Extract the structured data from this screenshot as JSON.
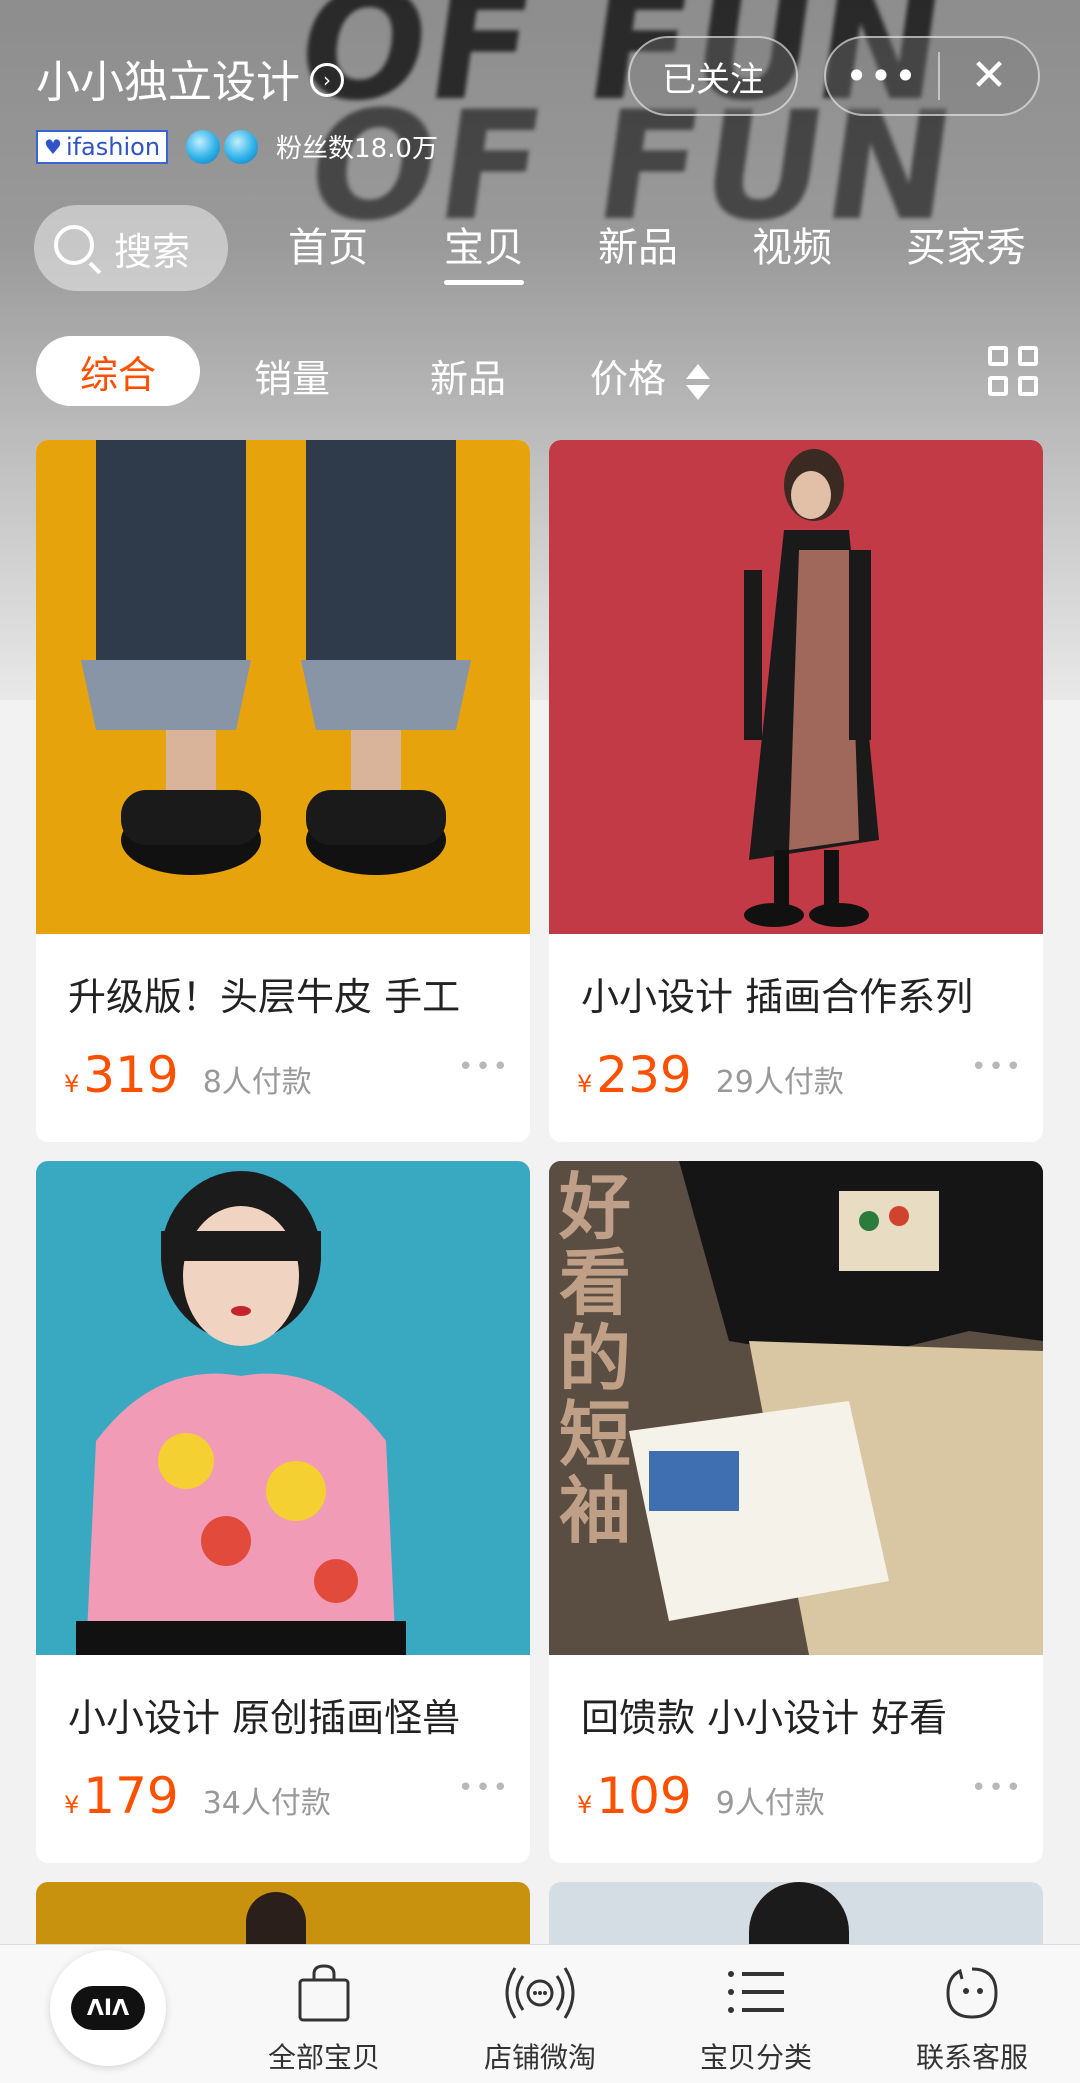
{
  "shop": {
    "name": "小小独立设计",
    "follow_label": "已关注",
    "badge_label": "ifashion",
    "fans_text": "粉丝数18.0万"
  },
  "window_controls": {
    "more_icon": "more-dots-icon",
    "close_icon": "close-icon"
  },
  "search": {
    "label": "搜索"
  },
  "nav_tabs": [
    {
      "label": "首页"
    },
    {
      "label": "宝贝",
      "active": true
    },
    {
      "label": "新品"
    },
    {
      "label": "视频"
    },
    {
      "label": "买家秀"
    }
  ],
  "sort": {
    "items": [
      {
        "label": "综合",
        "active": true
      },
      {
        "label": "销量"
      },
      {
        "label": "新品"
      },
      {
        "label": "价格"
      }
    ]
  },
  "products": [
    {
      "title": "升级版！头层牛皮 手工",
      "yen": "¥",
      "price": "319",
      "sold": "8人付款"
    },
    {
      "title": "小小设计 插画合作系列",
      "yen": "¥",
      "price": "239",
      "sold": "29人付款"
    },
    {
      "title": "小小设计 原创插画怪兽",
      "yen": "¥",
      "price": "179",
      "sold": "34人付款"
    },
    {
      "title": "回馈款 小小设计  好看",
      "yen": "¥",
      "price": "109",
      "sold": "9人付款"
    }
  ],
  "product_image_overlay": {
    "tee_text": [
      "好",
      "看",
      "的",
      "短",
      "袖"
    ]
  },
  "bottom_tabs": [
    {
      "label": "全部宝贝",
      "icon": "shopping-bag-icon"
    },
    {
      "label": "店铺微淘",
      "icon": "broadcast-icon"
    },
    {
      "label": "宝贝分类",
      "icon": "list-icon"
    },
    {
      "label": "联系客服",
      "icon": "chat-face-icon"
    }
  ],
  "colors": {
    "accent": "#ff5000",
    "badge_blue": "#2d54c8"
  }
}
